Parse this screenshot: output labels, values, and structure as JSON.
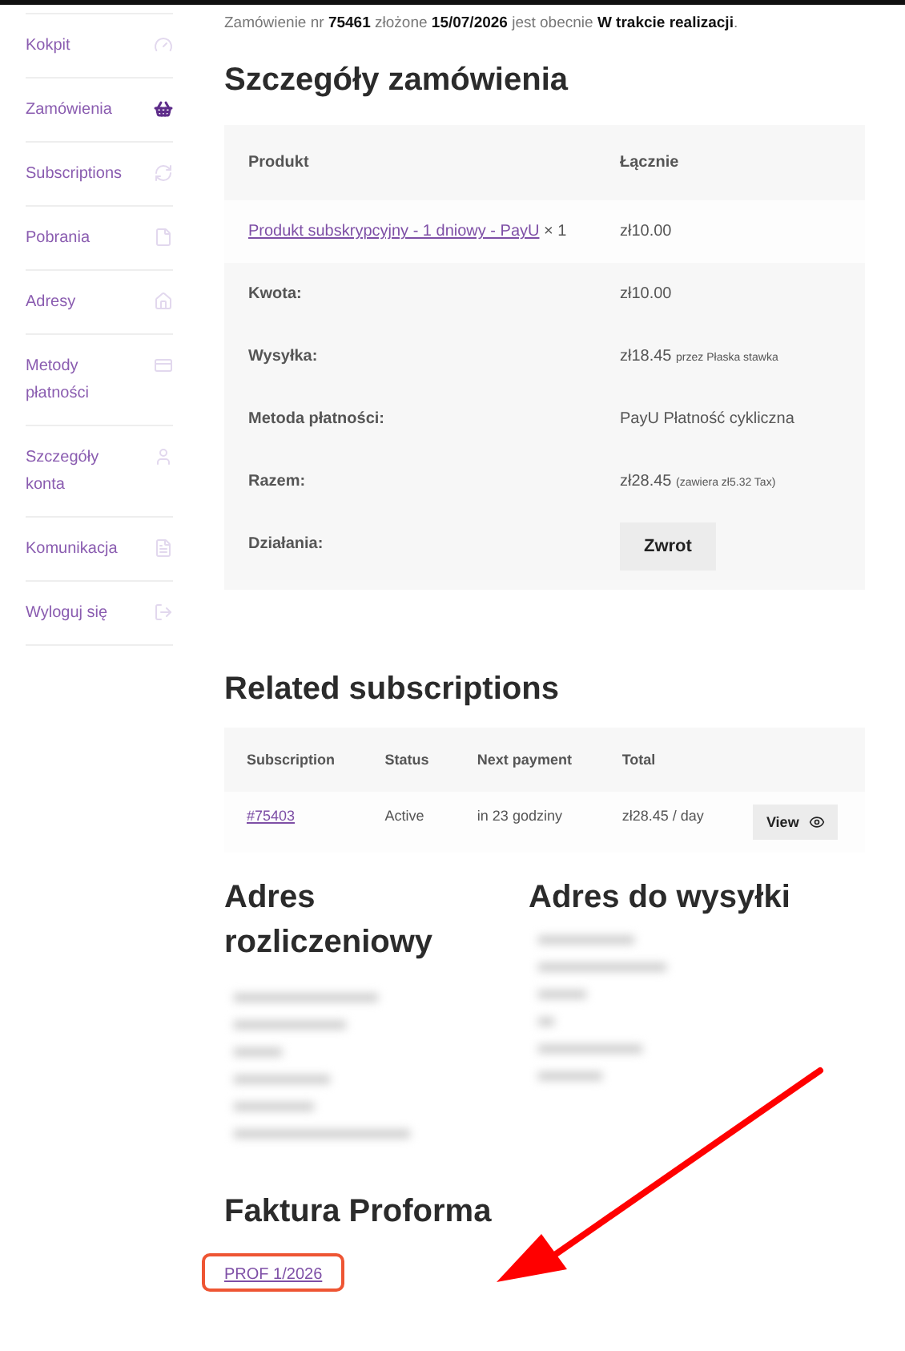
{
  "sidebar": {
    "items": [
      {
        "label": "Kokpit",
        "selected": false
      },
      {
        "label": "Zamówienia",
        "selected": true
      },
      {
        "label": "Subscriptions",
        "selected": false
      },
      {
        "label": "Pobrania",
        "selected": false
      },
      {
        "label": "Adresy",
        "selected": false
      },
      {
        "label": "Metody płatności",
        "selected": false
      },
      {
        "label": "Szczegóły konta",
        "selected": false
      },
      {
        "label": "Komunikacja",
        "selected": false
      },
      {
        "label": "Wyloguj się",
        "selected": false
      }
    ]
  },
  "notice": "Zamówienie nr **75461** złożone **15/07/2026** jest obecnie **W trakcie realizacji**.",
  "order_details": {
    "title": "Szczegóły zamówienia",
    "columns": [
      "Produkt",
      "Łącznie"
    ],
    "item": {
      "product": "Produkt subskrypcyjny - 1 dniowy - PayU",
      "quantity": "× 1",
      "total": "zł10.00"
    },
    "totals": [
      {
        "label": "Kwota:",
        "value": "zł10.00"
      },
      {
        "label": "Wysyłka:",
        "value": "zł18.45",
        "note": "przez Płaska stawka"
      },
      {
        "label": "Metoda płatności:",
        "value": "PayU Płatność cykliczna"
      },
      {
        "label": "Razem:",
        "value": "zł28.45",
        "note": "(zawiera zł5.32 Tax)"
      }
    ],
    "actions": {
      "label": "Działania:",
      "button": "Zwrot"
    }
  },
  "related_subscriptions": {
    "title": "Related subscriptions",
    "columns": [
      "Subscription",
      "Status",
      "Next payment",
      "Total"
    ],
    "rows": [
      {
        "subscription": "#75403",
        "status": "Active",
        "next_payment": "in 23 godziny",
        "total": "zł28.45 / day",
        "button": "View"
      }
    ]
  },
  "billing_address": {
    "title": "Adres rozliczeniowy"
  },
  "shipping_address": {
    "title": "Adres do wysyłki"
  },
  "proforma": {
    "title": "Faktura Proforma",
    "link": "PROF 1/2026"
  }
}
